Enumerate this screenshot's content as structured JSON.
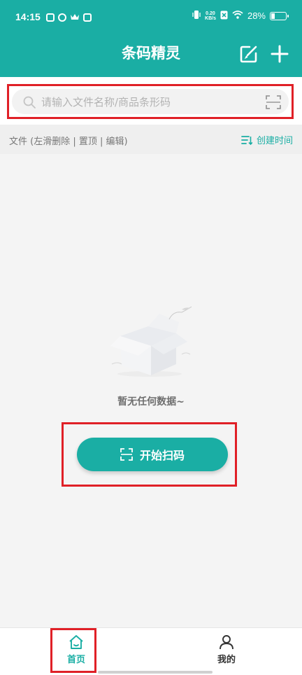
{
  "status_bar": {
    "time": "14:15",
    "net_speed_value": "0.20",
    "net_speed_unit": "KB/s",
    "battery_text": "28%",
    "battery_level": 0.28
  },
  "header": {
    "title": "条码精灵",
    "edit_icon": "edit-icon",
    "add_icon": "plus-icon",
    "background_color": "#1aaea4"
  },
  "search": {
    "placeholder": "请输入文件名称/商品条形码",
    "value": "",
    "left_icon": "search-icon",
    "right_icon": "scan-icon"
  },
  "file_bar": {
    "hint": "文件 (左滑删除 | 置顶 | 编辑)",
    "sort_label": "创建时间",
    "sort_icon": "sort-icon"
  },
  "empty_state": {
    "illustration": "empty-box-illustration",
    "message": "暂无任何数据~"
  },
  "start_scan": {
    "label": "开始扫码",
    "icon": "scan-icon"
  },
  "tabs": [
    {
      "label": "首页",
      "icon": "home-icon",
      "active": true
    },
    {
      "label": "我的",
      "icon": "user-icon",
      "active": false
    }
  ],
  "colors": {
    "accent": "#1aaea4",
    "highlight_frame": "#e02027"
  }
}
